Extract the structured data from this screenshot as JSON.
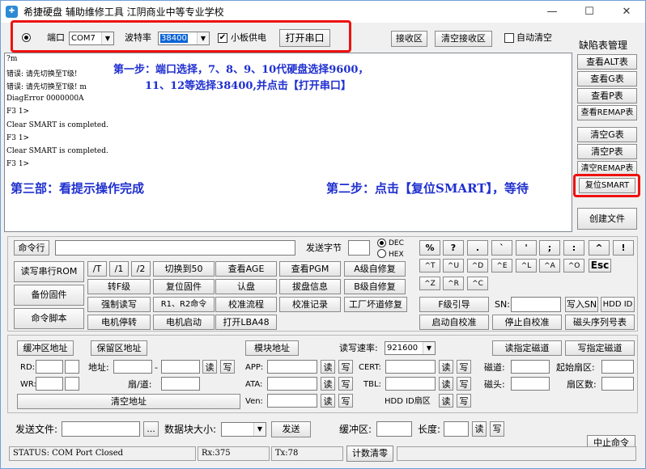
{
  "window": {
    "title": "希捷硬盘 辅助维修工具      江阴商业中等专业学校",
    "min": "—",
    "max": "☐",
    "close": "✕"
  },
  "top": {
    "port_label": "端口",
    "port_value": "COM7",
    "baud_label": "波特率",
    "baud_value": "38400",
    "board_power": "小板供电",
    "open_port": "打开串口",
    "recv_area": "接收区",
    "clear_recv": "清空接收区",
    "auto_clear": "自动清空"
  },
  "output": {
    "lines": [
      "?m",
      "错误: 请先切换至T级!",
      "错误: 请先切换至T级! m",
      "DiagError 0000000A",
      "F3 1>",
      "Clear SMART is completed.",
      "F3 1>",
      "Clear SMART is completed.",
      "F3 1>"
    ]
  },
  "annotations": {
    "step1_a": "第一步：端口选择，7、8、9、10代硬盘选择9600，",
    "step1_b": "11、12等选择38400,并点击【打开串口】",
    "step3": "第三部：看提示操作完成",
    "step2": "第二步：点击【复位SMART】，等待"
  },
  "defect": {
    "title": "缺陷表管理",
    "view_alt": "查看ALT表",
    "view_g": "查看G表",
    "view_p": "查看P表",
    "view_remap": "查看REMAP表",
    "clear_g": "清空G表",
    "clear_p": "清空P表",
    "clear_remap": "清空REMAP表",
    "reset_smart": "复位SMART",
    "create_file": "创建文件"
  },
  "cmd": {
    "cmd_line": "命令行",
    "send_bytes": "发送字节",
    "dec": "DEC",
    "hex": "HEX"
  },
  "keys": {
    "row1": [
      "%",
      "?",
      ".",
      "`",
      "'",
      ";",
      ":",
      "^",
      "!"
    ],
    "row2": [
      "^T",
      "^U",
      "^D",
      "^E",
      "^L",
      "^A",
      "^O",
      "Esc"
    ],
    "row3": [
      "^Z",
      "^R",
      "^C"
    ]
  },
  "left_btns": {
    "read_rom": "读写串行ROM",
    "backup": "备份固件",
    "script": "命令脚本"
  },
  "grid": {
    "r1": [
      "/T",
      "/1",
      "/2",
      "切换到50",
      "查看AGE",
      "查看PGM",
      "A级自修复"
    ],
    "r2": [
      "转F级",
      "复位固件",
      "认盘",
      "拔盘信息",
      "B级自修复"
    ],
    "r3": [
      "强制读写",
      "R1、R2命令",
      "校准流程",
      "校准记录",
      "工厂坏道修复"
    ],
    "r4": [
      "电机停转",
      "电机启动",
      "打开LBA48"
    ]
  },
  "mid": {
    "f_guide": "F级引导",
    "sn": "SN:",
    "write_sn": "写入SN",
    "hdd_id": "HDD ID",
    "auto_cal": "启动自校准",
    "stop_cal": "停止自校准",
    "head_seq": "磁头序列号表"
  },
  "buf": {
    "buffer_addr": "缓冲区地址",
    "reserved_addr": "保留区地址",
    "module_addr": "模块地址",
    "rw_speed": "读写速率:",
    "speed_value": "921600",
    "read_track": "读指定磁道",
    "write_track": "写指定磁道",
    "rd": "RD:",
    "wr": "WR:",
    "addr": "地址:",
    "fan": "扇/道:",
    "clear_addr": "清空地址",
    "read": "读",
    "write": "写",
    "app": "APP:",
    "ata": "ATA:",
    "ven": "Ven:",
    "cert": "CERT:",
    "tbl": "TBL:",
    "hdd_id_area": "HDD ID扇区",
    "track": "磁道:",
    "head": "磁头:",
    "start_sector": "起始扇区:",
    "sector_count": "扇区数:"
  },
  "send": {
    "send_file": "发送文件:",
    "browse": "...",
    "block_size": "数据块大小:",
    "send": "发送",
    "buffer": "缓冲区:",
    "length": "长度:",
    "read": "读",
    "write": "写",
    "stop": "中止命令"
  },
  "status": {
    "text": "STATUS: COM Port Closed",
    "rx": "Rx:375",
    "tx": "Tx:78",
    "reset_count": "计数清零"
  }
}
